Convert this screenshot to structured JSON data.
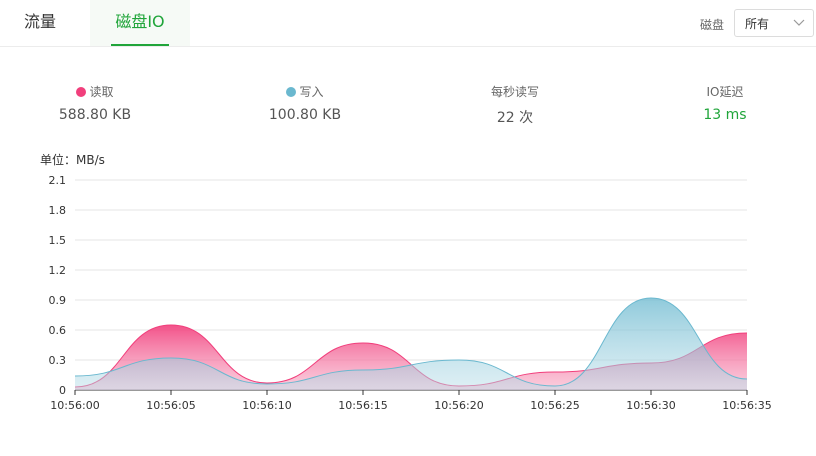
{
  "tabs": {
    "traffic": "流量",
    "disk_io": "磁盘IO"
  },
  "disk_filter": {
    "label": "磁盘",
    "selected": "所有"
  },
  "stats": {
    "read": {
      "label": "读取",
      "value": "588.80 KB",
      "color": "#f13f7c"
    },
    "write": {
      "label": "写入",
      "value": "100.80 KB",
      "color": "#6ab8cf"
    },
    "iops": {
      "label": "每秒读写",
      "value": "22 次"
    },
    "latency": {
      "label": "IO延迟",
      "value": "13 ms",
      "color": "#20a53a"
    }
  },
  "unit_label": "单位：MB/s",
  "chart_data": {
    "type": "area",
    "ylim": [
      0,
      2.1
    ],
    "yticks": [
      "0",
      "0.3",
      "0.6",
      "0.9",
      "1.2",
      "1.5",
      "1.8",
      "2.1"
    ],
    "categories": [
      "10:56:00",
      "10:56:05",
      "10:56:10",
      "10:56:15",
      "10:56:20",
      "10:56:25",
      "10:56:30",
      "10:56:35"
    ],
    "grid": true,
    "series": [
      {
        "name": "读取",
        "color": "#f13f7c",
        "values": [
          0.03,
          0.65,
          0.07,
          0.47,
          0.04,
          0.18,
          0.27,
          0.57
        ]
      },
      {
        "name": "写入",
        "color": "#6ab8cf",
        "values": [
          0.14,
          0.32,
          0.06,
          0.2,
          0.3,
          0.04,
          0.92,
          0.11
        ]
      }
    ]
  }
}
